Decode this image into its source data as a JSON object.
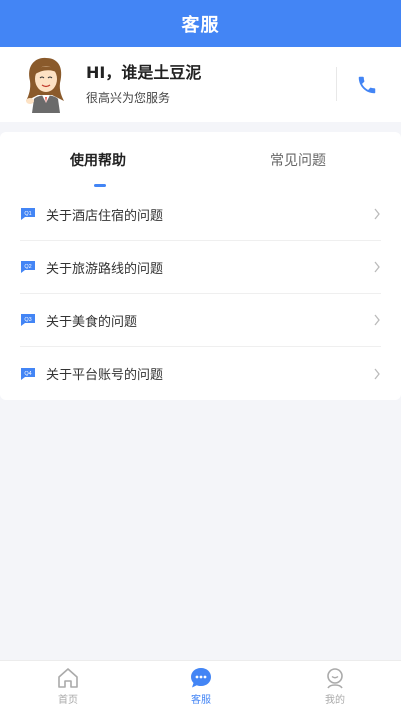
{
  "header": {
    "title": "客服"
  },
  "agent": {
    "greeting": "HI，谁是土豆泥",
    "subtext": "很高兴为您服务"
  },
  "help": {
    "tabs": [
      {
        "label": "使用帮助",
        "active": true
      },
      {
        "label": "常见问题",
        "active": false
      }
    ],
    "questions": [
      {
        "badge": "Q1",
        "label": "关于酒店住宿的问题"
      },
      {
        "badge": "Q2",
        "label": "关于旅游路线的问题"
      },
      {
        "badge": "Q3",
        "label": "关于美食的问题"
      },
      {
        "badge": "Q4",
        "label": "关于平台账号的问题"
      }
    ]
  },
  "tabbar": {
    "items": [
      {
        "label": "首页",
        "icon": "home-icon",
        "active": false
      },
      {
        "label": "客服",
        "icon": "chat-icon",
        "active": true
      },
      {
        "label": "我的",
        "icon": "user-icon",
        "active": false
      }
    ]
  },
  "colors": {
    "accent": "#4385f5",
    "background": "#f4f5f9"
  }
}
